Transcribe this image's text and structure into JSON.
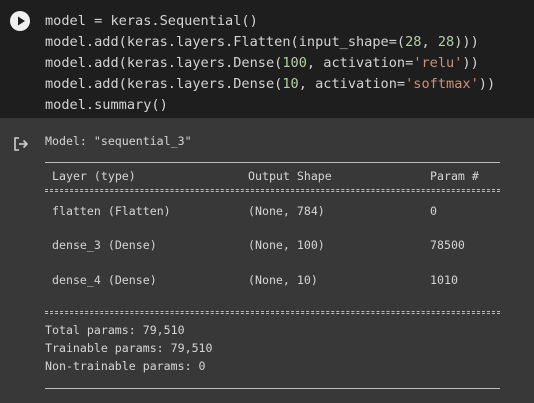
{
  "code": {
    "lines": [
      [
        "model = keras.Sequential()"
      ],
      [
        "model.add(keras.layers.Flatten(input_shape=(",
        "28",
        ", ",
        "28",
        ")))"
      ],
      [
        "model.add(keras.layers.Dense(",
        "100",
        ", activation=",
        "'relu'",
        "))"
      ],
      [
        "model.add(keras.layers.Dense(",
        "10",
        ", activation=",
        "'softmax'",
        "))"
      ],
      [
        "model.summary()"
      ]
    ]
  },
  "output": {
    "model_title": "Model: \"sequential_3\"",
    "headers": {
      "layer": "Layer (type)",
      "shape": "Output Shape",
      "params": "Param #"
    },
    "rows": [
      {
        "layer": "flatten (Flatten)",
        "shape": "(None, 784)",
        "params": "0"
      },
      {
        "layer": "dense_3 (Dense)",
        "shape": "(None, 100)",
        "params": "78500"
      },
      {
        "layer": "dense_4 (Dense)",
        "shape": "(None, 10)",
        "params": "1010"
      }
    ],
    "total_params": "Total params: 79,510",
    "trainable_params": "Trainable params: 79,510",
    "non_trainable_params": "Non-trainable params: 0"
  },
  "colors": {
    "code_bg": "#1e1e1e",
    "output_bg": "#383838",
    "number": "#b5cea8",
    "string": "#ce9178",
    "text": "#d4d4d4"
  },
  "icons": {
    "run": "play-icon",
    "output": "output-redirect-icon"
  }
}
